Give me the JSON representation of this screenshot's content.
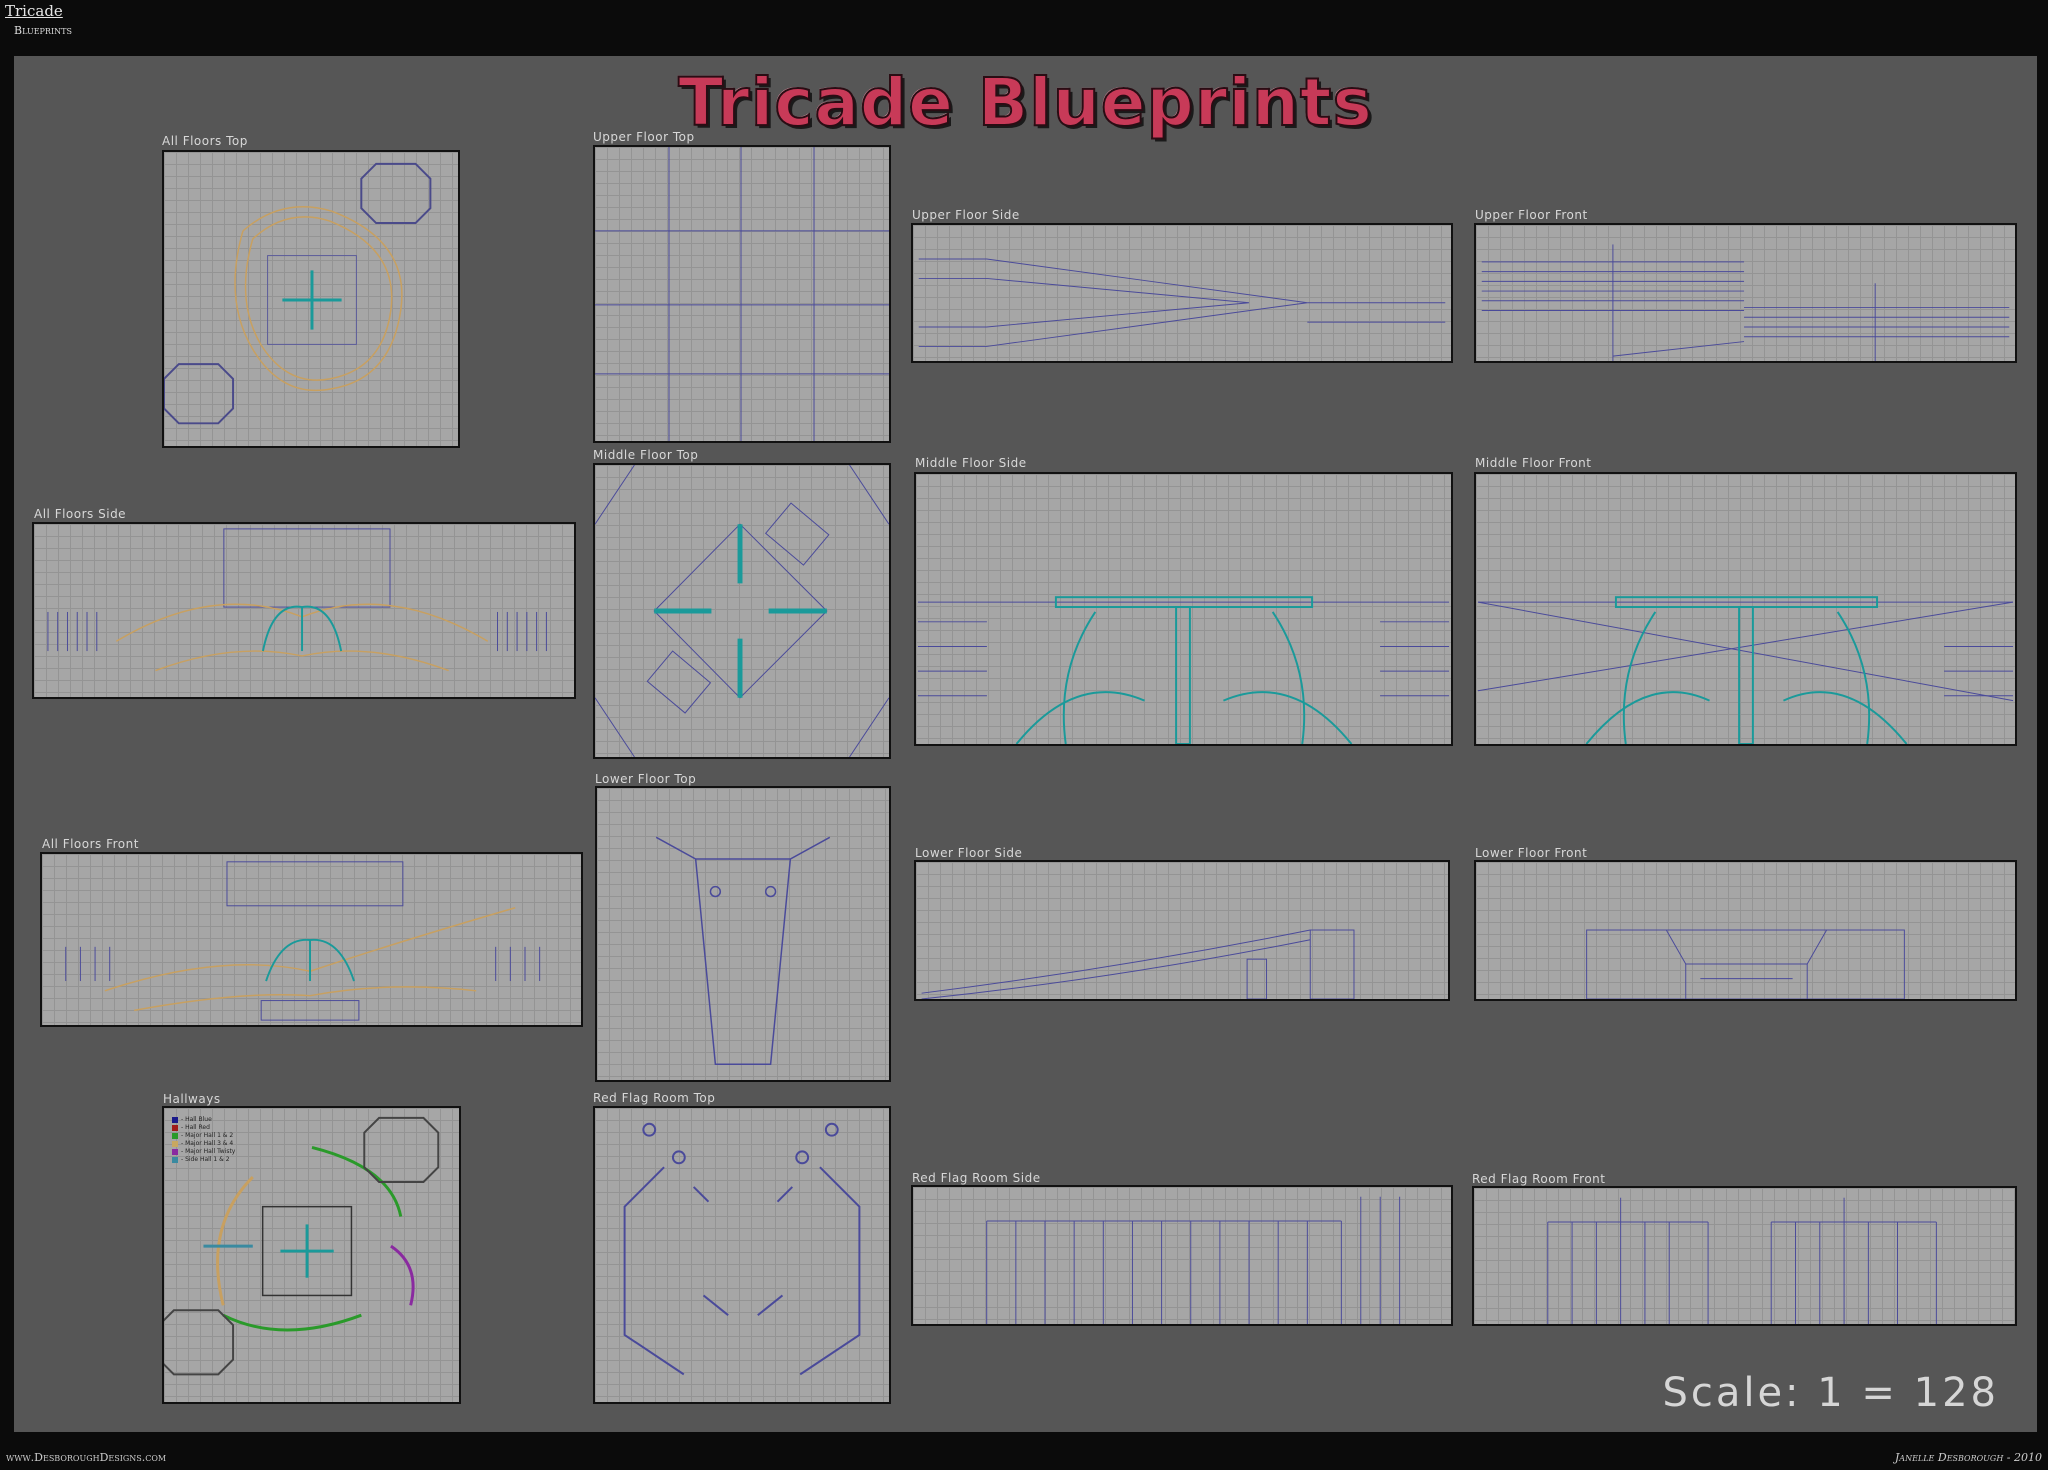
{
  "header": {
    "title": "Tricade",
    "subtitle": "Blueprints"
  },
  "board": {
    "title": "Tricade Blueprints",
    "scale": "Scale: 1 = 128"
  },
  "panels": {
    "all_floors_top": "All Floors Top",
    "all_floors_side": "All Floors Side",
    "all_floors_front": "All Floors Front",
    "hallways": "Hallways",
    "upper_floor_top": "Upper Floor Top",
    "middle_floor_top": "Middle Floor Top",
    "lower_floor_top": "Lower Floor Top",
    "red_flag_room_top": "Red Flag Room Top",
    "upper_floor_side": "Upper Floor Side",
    "upper_floor_front": "Upper Floor Front",
    "middle_floor_side": "Middle Floor Side",
    "middle_floor_front": "Middle Floor Front",
    "lower_floor_side": "Lower Floor Side",
    "lower_floor_front": "Lower Floor Front",
    "red_flag_room_side": "Red Flag Room Side",
    "red_flag_room_front": "Red Flag Room Front"
  },
  "legend": [
    {
      "label": "- Hall Blue",
      "color": "#1a1a8a"
    },
    {
      "label": "- Hall Red",
      "color": "#a01a1a"
    },
    {
      "label": "- Major Hall 1 & 2",
      "color": "#2a9a2a"
    },
    {
      "label": "- Major Hall 3 & 4",
      "color": "#c8a860"
    },
    {
      "label": "- Major Hall Twisty",
      "color": "#8a2aa0"
    },
    {
      "label": "- Side Hall 1 & 2",
      "color": "#3a8aa0"
    }
  ],
  "footer": {
    "left": "www.DesboroughDesigns.com",
    "right": "Janelle Desborough - 2010"
  },
  "colors": {
    "background": "#565656",
    "panel": "#a6a6a6",
    "blueprint_line": "#3a3a8a",
    "teal": "#1a9a9a",
    "orange": "#c8a060",
    "title": "#c83a58"
  }
}
